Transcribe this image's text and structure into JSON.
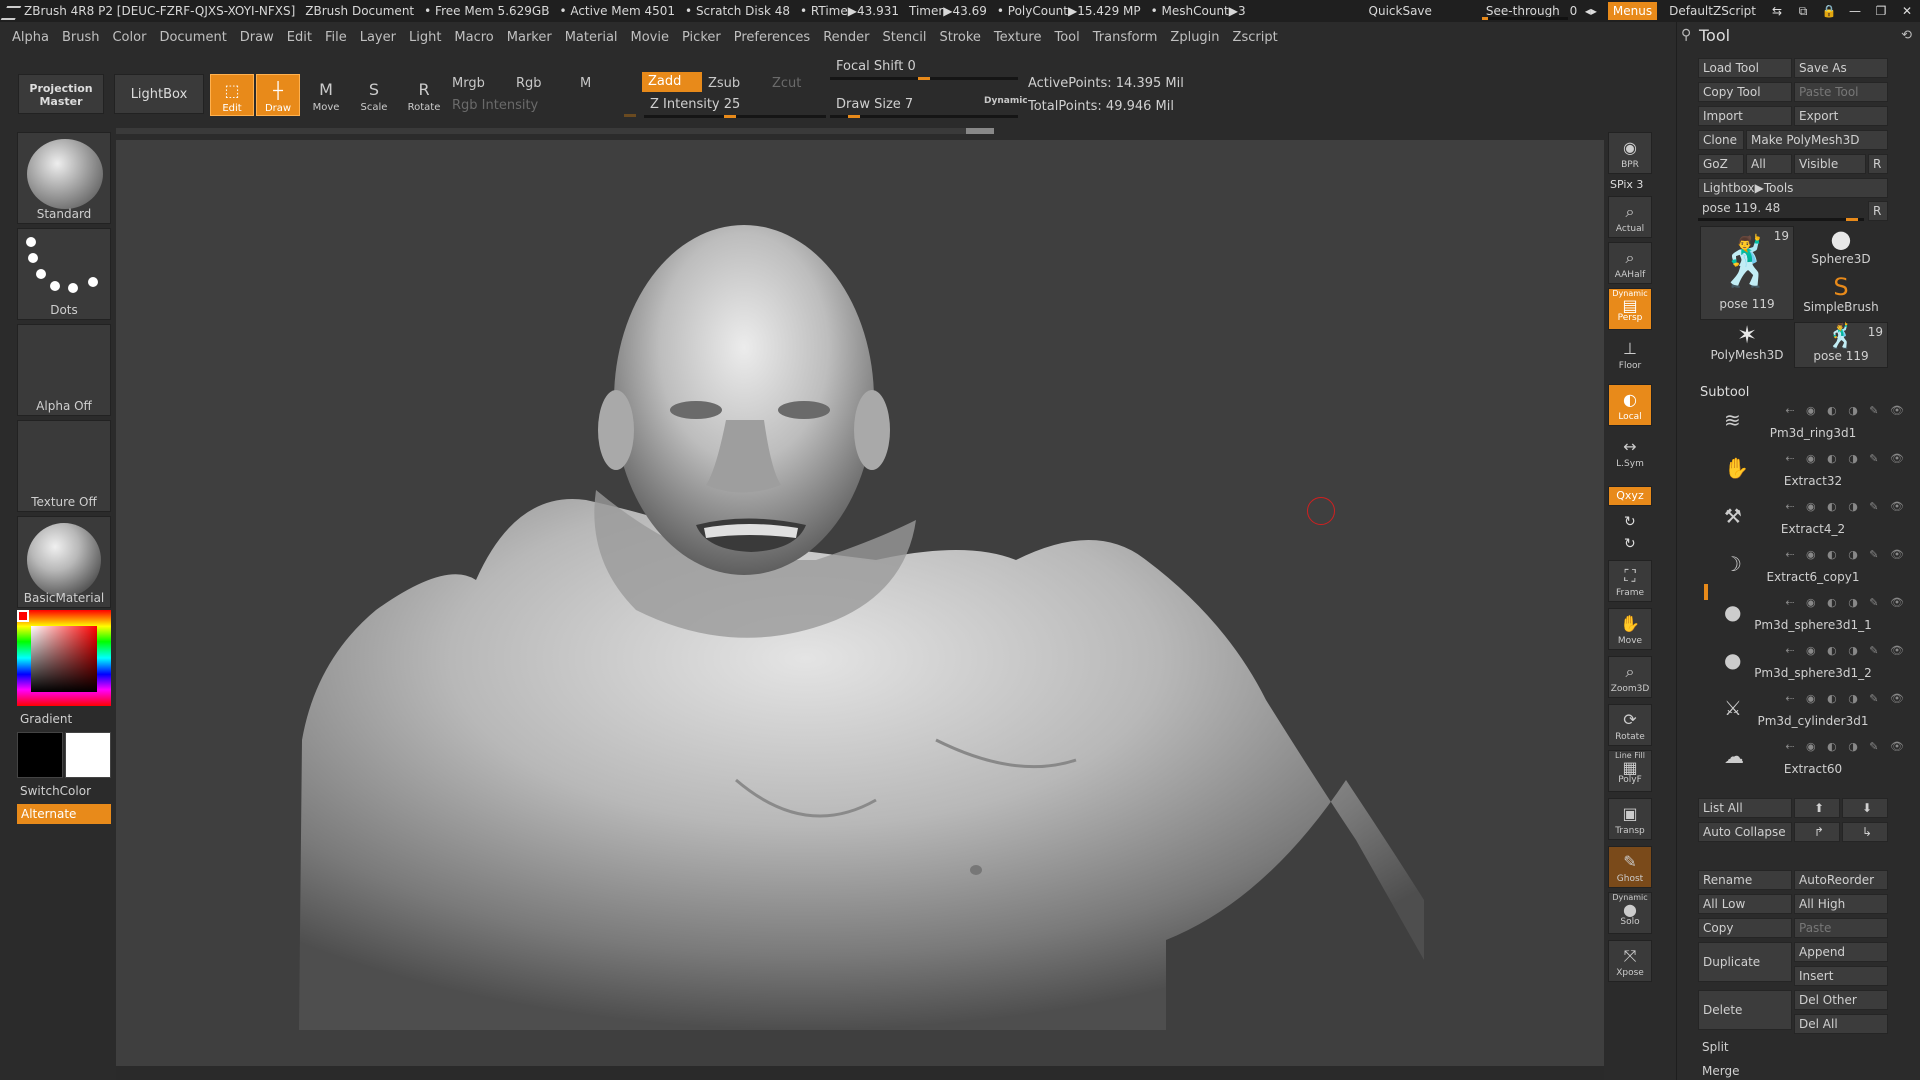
{
  "titlebar": {
    "app": "ZBrush 4R8 P2 [DEUC-FZRF-QJXS-XOYI-NFXS]",
    "doc": "ZBrush Document",
    "free_mem": "• Free Mem 5.629GB",
    "active_mem": "• Active Mem 4501",
    "scratch": "• Scratch Disk 48",
    "rtime": "• RTime▶43.931",
    "timer": "Timer▶43.69",
    "polycount": "• PolyCount▶15.429 MP",
    "meshcount": "• MeshCount▶3",
    "quicksave": "QuickSave",
    "see_through": "See-through",
    "see_through_value": "0",
    "see_through_fraction": 0,
    "menus": "Menus",
    "script": "DefaultZScript"
  },
  "menubar": [
    "Alpha",
    "Brush",
    "Color",
    "Document",
    "Draw",
    "Edit",
    "File",
    "Layer",
    "Light",
    "Macro",
    "Marker",
    "Material",
    "Movie",
    "Picker",
    "Preferences",
    "Render",
    "Stencil",
    "Stroke",
    "Texture",
    "Tool",
    "Transform",
    "Zplugin",
    "Zscript"
  ],
  "toolbar": {
    "projection_master": "Projection Master",
    "lightbox": "LightBox",
    "edit": "Edit",
    "draw": "Draw",
    "move": "Move",
    "scale": "Scale",
    "rotate": "Rotate",
    "mrgb": "Mrgb",
    "rgb": "Rgb",
    "m": "M",
    "rgb_intensity": "Rgb Intensity",
    "zadd": "Zadd",
    "zsub": "Zsub",
    "zcut": "Zcut",
    "z_intensity": "Z Intensity 25",
    "focal_shift": "Focal Shift 0",
    "draw_size": "Draw Size 7",
    "dynamic": "Dynamic",
    "active_points": "ActivePoints: 14.395 Mil",
    "total_points": "TotalPoints: 49.946 Mil"
  },
  "leftshelf": {
    "brush": "Standard",
    "stroke": "Dots",
    "alpha": "Alpha Off",
    "texture": "Texture Off",
    "material": "BasicMaterial",
    "gradient": "Gradient",
    "switch_color": "SwitchColor",
    "alternate": "Alternate"
  },
  "rightshelf": {
    "bpr": "BPR",
    "spix": "SPix 3",
    "actual": "Actual",
    "aahalf": "AAHalf",
    "dynamic": "Dynamic",
    "persp": "Persp",
    "floor": "Floor",
    "local": "Local",
    "lsym": "L.Sym",
    "xyz": "Qxyz",
    "frame": "Frame",
    "move": "Move",
    "zoom3d": "Zoom3D",
    "rotate": "Rotate",
    "line_fill": "Line Fill",
    "polyf": "PolyF",
    "transp": "Transp",
    "ghost": "Ghost",
    "dynamic2": "Dynamic",
    "solo": "Solo",
    "xpose": "Xpose"
  },
  "tool": {
    "title": "Tool",
    "load_tool": "Load Tool",
    "save_as": "Save As",
    "copy_tool": "Copy Tool",
    "paste_tool": "Paste Tool",
    "import": "Import",
    "export": "Export",
    "clone": "Clone",
    "make_polymesh": "Make PolyMesh3D",
    "goz": "GoZ",
    "all": "All",
    "visible": "Visible",
    "r": "R",
    "lightbox_tools": "Lightbox▶Tools",
    "pose_slider": "pose 119. 48",
    "thumbs": [
      {
        "name": "pose 119",
        "count": "19"
      },
      {
        "name": "Sphere3D",
        "count": ""
      },
      {
        "name": "SimpleBrush",
        "count": ""
      },
      {
        "name": "PolyMesh3D",
        "count": ""
      },
      {
        "name": "pose 119",
        "count": "19"
      }
    ],
    "subtool_header": "Subtool",
    "subtools": [
      "Pm3d_ring3d1",
      "Extract32",
      "Extract4_2",
      "Extract6_copy1",
      "Pm3d_sphere3d1_1",
      "Pm3d_sphere3d1_2",
      "Pm3d_cylinder3d1",
      "Extract60"
    ],
    "list_all": "List All",
    "auto_collapse": "Auto Collapse",
    "rename": "Rename",
    "autoreorder": "AutoReorder",
    "all_low": "All Low",
    "all_high": "All High",
    "copy": "Copy",
    "paste": "Paste",
    "duplicate": "Duplicate",
    "append": "Append",
    "insert": "Insert",
    "delete": "Delete",
    "del_other": "Del Other",
    "del_all": "Del All",
    "split": "Split",
    "merge": "Merge"
  },
  "colors": {
    "accent": "#e88a1a",
    "panel": "#2b2b2b",
    "canvas": "#3f3f3f"
  }
}
